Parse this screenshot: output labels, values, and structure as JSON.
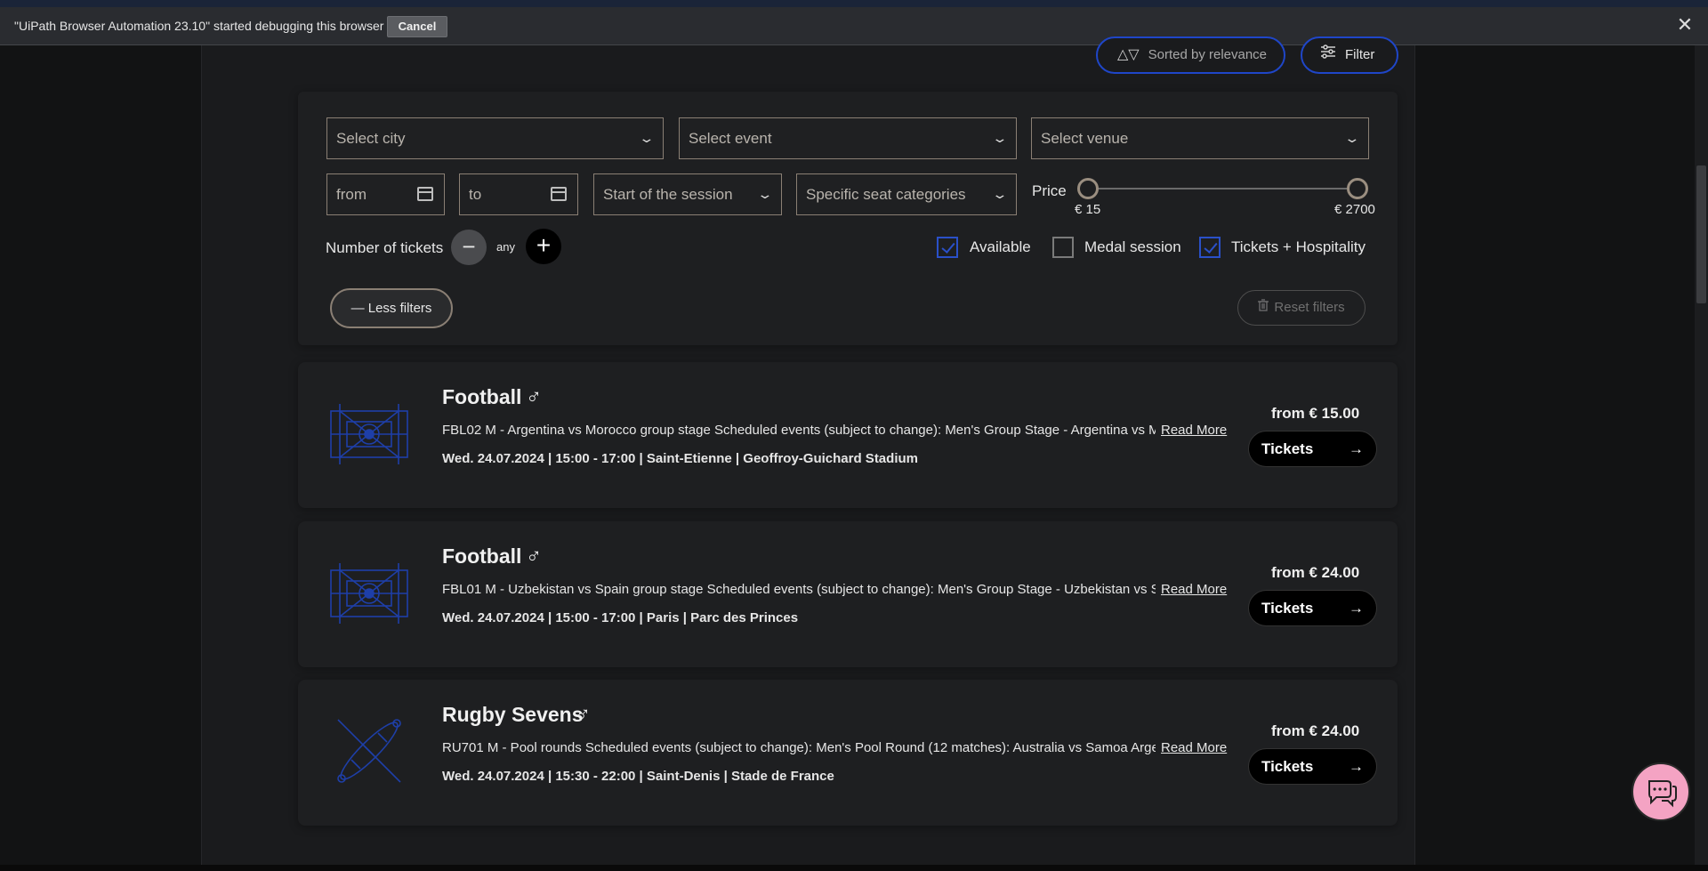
{
  "debug_bar": {
    "message": "\"UiPath Browser Automation 23.10\" started debugging this browser",
    "cancel_label": "Cancel",
    "close_glyph": "✕"
  },
  "toolbar": {
    "sort_label": "Sorted by relevance",
    "sort_icon": "sort-arrows-icon",
    "filter_label": "Filter",
    "filter_icon": "sliders-icon"
  },
  "filters": {
    "city_placeholder": "Select city",
    "event_placeholder": "Select event",
    "venue_placeholder": "Select venue",
    "from_placeholder": "from",
    "to_placeholder": "to",
    "session_placeholder": "Start of the session",
    "seat_placeholder": "Specific seat categories",
    "price_label": "Price",
    "price_min": "€ 15",
    "price_max": "€ 2700",
    "tickets_label": "Number of tickets",
    "tickets_value": "any",
    "checkboxes": [
      {
        "label": "Available",
        "checked": true
      },
      {
        "label": "Medal session",
        "checked": false
      },
      {
        "label": "Tickets + Hospitality",
        "checked": true
      }
    ],
    "less_filters_label": "— Less filters",
    "reset_label": "Reset filters"
  },
  "events": [
    {
      "sport": "Football",
      "gender_symbol": "♂",
      "description": "FBL02 M - Argentina vs Morocco group stage Scheduled events (subject to change): Men's Group Stage - Argentina vs Morocco",
      "read_more": "Read More",
      "meta": "Wed. 24.07.2024 |  15:00 - 17:00  |  Saint-Etienne  |   Geoffroy-Guichard Stadium",
      "price": "from € 15.00",
      "tickets_label": "Tickets"
    },
    {
      "sport": "Football",
      "gender_symbol": "♂",
      "description": "FBL01 M - Uzbekistan vs Spain group stage Scheduled events (subject to change): Men's Group Stage - Uzbekistan vs Spain",
      "read_more": "Read More",
      "meta": "Wed. 24.07.2024 |  15:00 - 17:00  |  Paris  |   Parc des Princes",
      "price": "from € 24.00",
      "tickets_label": "Tickets"
    },
    {
      "sport": "Rugby Sevens",
      "gender_symbol": "♂",
      "description": "RU701 M - Pool rounds Scheduled events (subject to change): Men's Pool Round (12 matches): Australia vs Samoa Argentina",
      "read_more": "Read More",
      "meta": "Wed. 24.07.2024 |  15:30 - 22:00  |  Saint-Denis  |   Stade de France",
      "price": "from € 24.00",
      "tickets_label": "Tickets"
    }
  ],
  "colors": {
    "accent_blue": "#1f46c8",
    "background": "#1a1b1d",
    "chat_pink": "#f4a3c3"
  }
}
